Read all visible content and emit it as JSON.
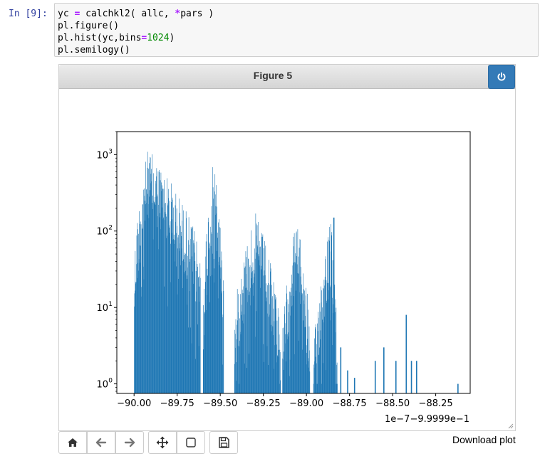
{
  "cell": {
    "prompt": "In [9]:",
    "lines": {
      "l1_a": "yc ",
      "l1_op": "=",
      "l1_b": " calchkl2( allc, ",
      "l1_star": "*",
      "l1_c": "pars )",
      "l2": "pl.figure()",
      "l3_a": "pl.hist(yc,bins",
      "l3_op": "=",
      "l3_num": "1024",
      "l3_b": ")",
      "l4": "pl.semilogy()"
    }
  },
  "figure": {
    "title": "Figure 5",
    "power_icon": "power-icon",
    "bar_color": "#1f77b4"
  },
  "toolbar": {
    "buttons": [
      "home-icon",
      "back-arrow-icon",
      "forward-arrow-icon",
      "pan-move-icon",
      "zoom-rect-icon",
      "save-floppy-icon"
    ],
    "download_label": "Download plot"
  },
  "chart_data": {
    "type": "bar",
    "title": "",
    "xlabel": "",
    "ylabel": "",
    "x_offset_label": "1e−7−9.9999e−1",
    "yscale": "log",
    "xlim": [
      -90.1,
      -88.05
    ],
    "ylim": [
      0.75,
      2000
    ],
    "xticks": [
      -90.0,
      -89.75,
      -89.5,
      -89.25,
      -89.0,
      -88.75,
      -88.5,
      -88.25
    ],
    "xtick_labels": [
      "−90.00",
      "−89.75",
      "−89.50",
      "−89.25",
      "−89.00",
      "−88.75",
      "−88.50",
      "−88.25"
    ],
    "yticks": [
      1,
      10,
      100,
      1000
    ],
    "ytick_labels": [
      {
        "base": "10",
        "exp": "0"
      },
      {
        "base": "10",
        "exp": "1"
      },
      {
        "base": "10",
        "exp": "2"
      },
      {
        "base": "10",
        "exp": "3"
      }
    ],
    "clusters": [
      {
        "x0": -90.0,
        "x1": -89.615,
        "base": 40,
        "peak": 1200,
        "center": -89.92
      },
      {
        "x0": -89.6,
        "x1": -89.48,
        "base": 15,
        "peak": 900,
        "center": -89.54
      },
      {
        "x0": -89.42,
        "x1": -89.15,
        "base": 6,
        "peak": 180,
        "center": -89.3
      },
      {
        "x0": -89.14,
        "x1": -88.98,
        "base": 4,
        "peak": 150,
        "center": -89.06
      },
      {
        "x0": -88.96,
        "x1": -88.82,
        "base": 2,
        "peak": 150,
        "center": -88.86
      }
    ],
    "spikes": [
      {
        "x": -88.84,
        "y": 150
      },
      {
        "x": -88.8,
        "y": 3
      },
      {
        "x": -88.76,
        "y": 1.5
      },
      {
        "x": -88.72,
        "y": 1.2
      },
      {
        "x": -88.6,
        "y": 2
      },
      {
        "x": -88.55,
        "y": 3
      },
      {
        "x": -88.48,
        "y": 2
      },
      {
        "x": -88.42,
        "y": 8
      },
      {
        "x": -88.39,
        "y": 2
      },
      {
        "x": -88.36,
        "y": 2
      },
      {
        "x": -88.12,
        "y": 1
      }
    ]
  }
}
